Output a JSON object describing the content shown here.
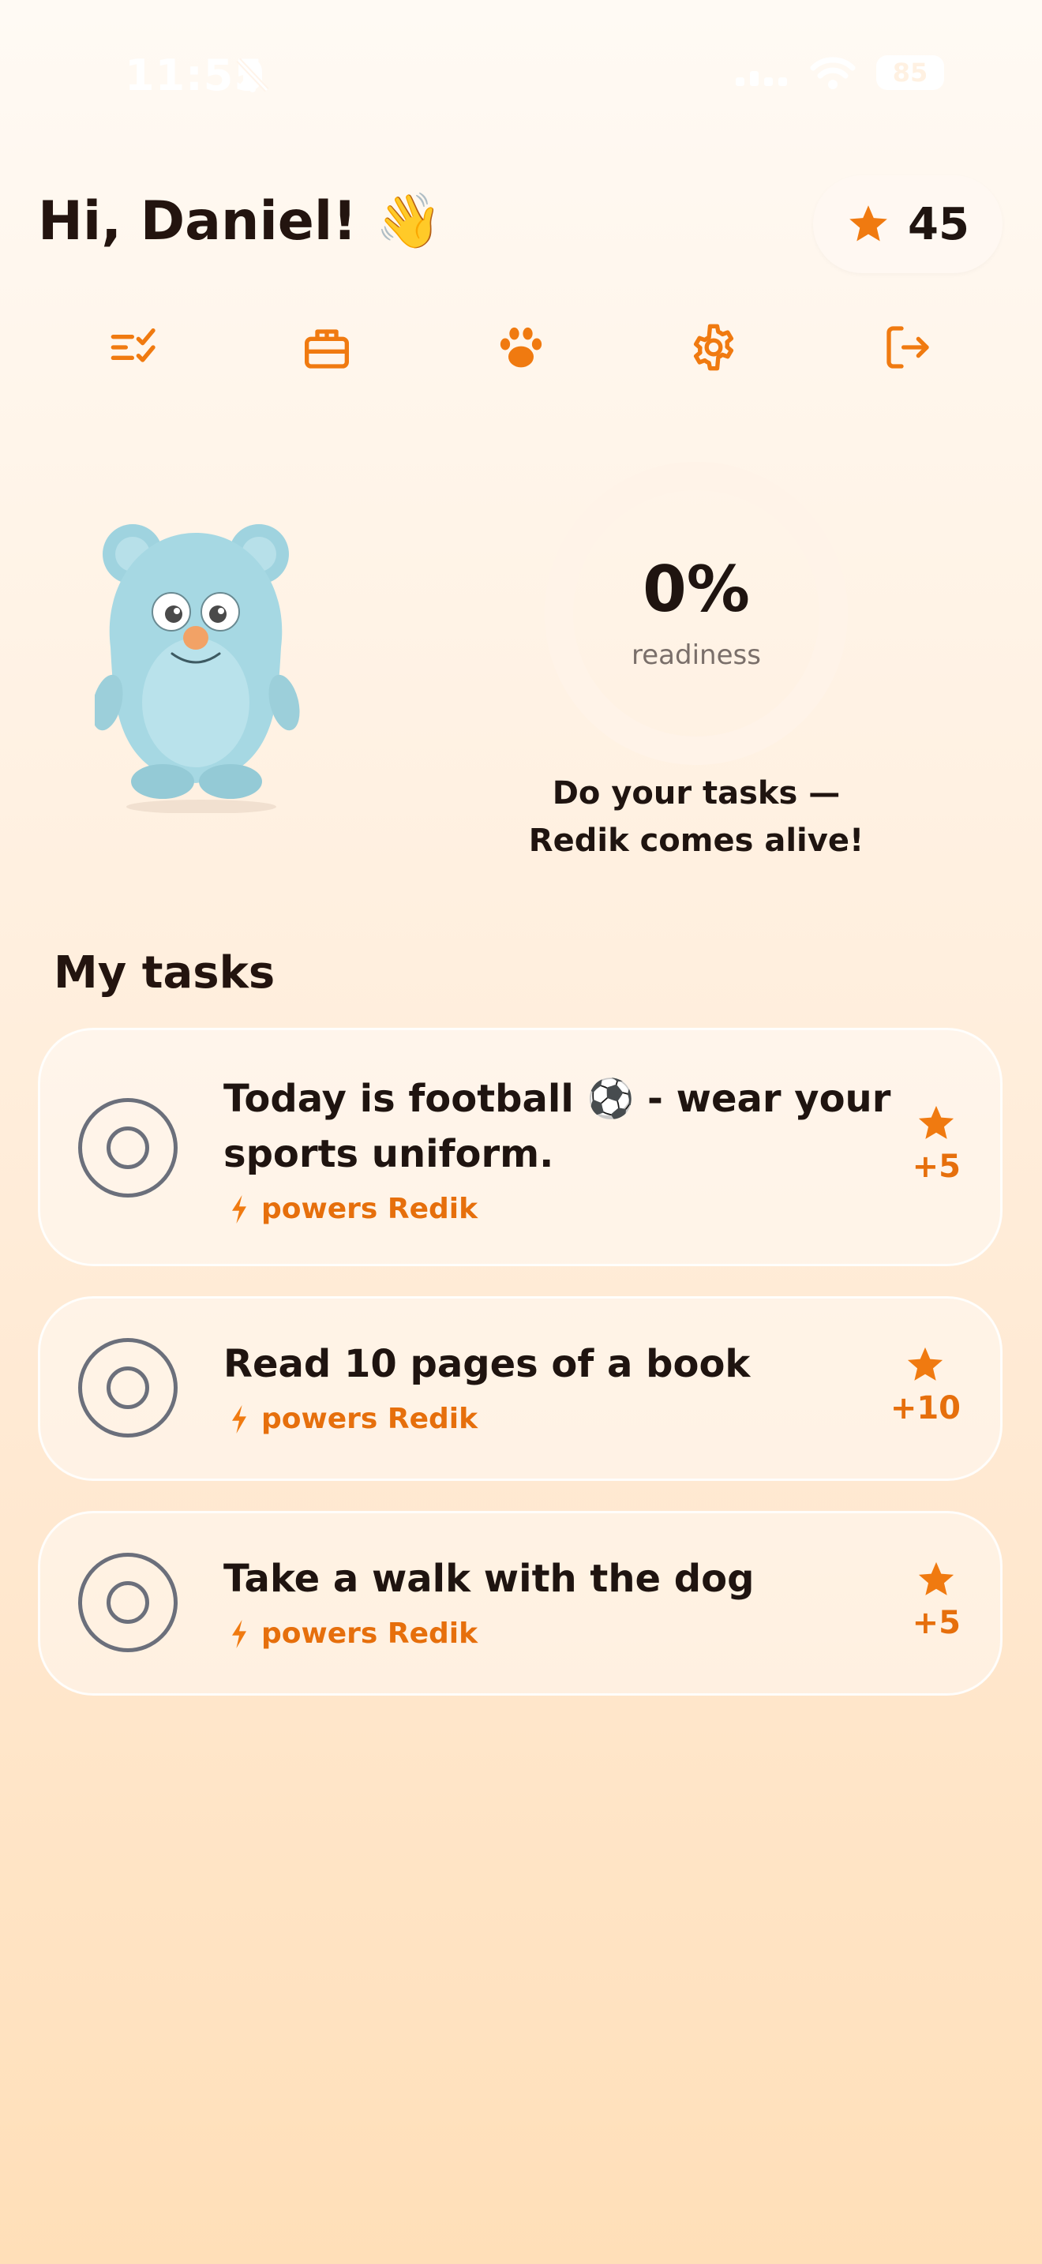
{
  "status_bar": {
    "time": "11:55",
    "battery": "85"
  },
  "header": {
    "greeting": "Hi, Daniel! 👋",
    "stars": "45"
  },
  "nav": [
    {
      "icon": "task-list-icon"
    },
    {
      "icon": "gift-icon"
    },
    {
      "icon": "paw-icon"
    },
    {
      "icon": "gear-icon"
    },
    {
      "icon": "logout-icon"
    }
  ],
  "pet": {
    "readiness_value": "0%",
    "readiness_label": "readiness",
    "motivation_line1": "Do your tasks —",
    "motivation_line2": "Redik comes alive!"
  },
  "tasks_section": {
    "title": "My tasks"
  },
  "tasks": [
    {
      "title_line1": "Today is football ⚽  - wear your",
      "title_line2": "sports uniform.",
      "meta": "powers Redik",
      "reward": "+5"
    },
    {
      "title_line1": "Read 10 pages of a book",
      "meta": "powers Redik",
      "reward": "+10"
    },
    {
      "title_line1": "Take a walk with the dog",
      "meta": "powers Redik",
      "reward": "+5"
    }
  ],
  "colors": {
    "accent": "#F07A10",
    "text": "#1F1410",
    "muted": "#7A6F6A",
    "checkbox": "#6B6F7B"
  }
}
